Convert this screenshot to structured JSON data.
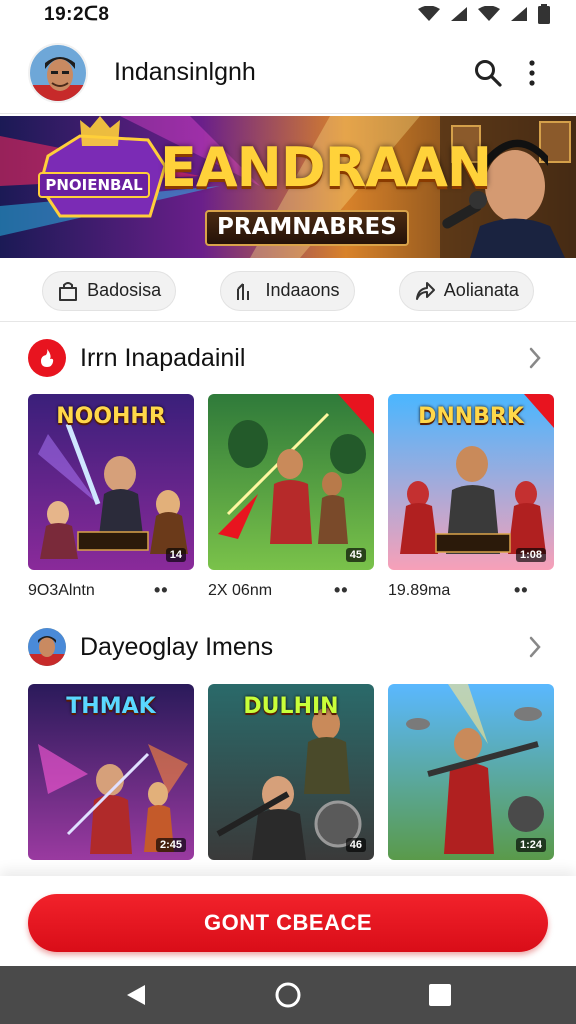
{
  "status_bar": {
    "time": "19:2ᑕ8"
  },
  "app_bar": {
    "title": "Indansinlgnh"
  },
  "banner": {
    "headline": "EANDRAAN",
    "subtitle": "PRAMNABRES",
    "badge": "PNOIENBAL"
  },
  "chips": [
    {
      "label": "Badosisa",
      "icon": "bag-icon"
    },
    {
      "label": "Indaaons",
      "icon": "bars-icon"
    },
    {
      "label": "Aolianata",
      "icon": "share-icon"
    }
  ],
  "sections": [
    {
      "title": "Irrn Inapadainil",
      "icon": "fire-icon",
      "items": [
        {
          "thumb_title": "NOOHHR",
          "duration": "14",
          "meta": "9О3Alntn"
        },
        {
          "thumb_title": "",
          "duration": "45",
          "meta": "2X 06nm"
        },
        {
          "thumb_title": "DNNBRK",
          "duration": "1:08",
          "meta": "19.89ma"
        }
      ]
    },
    {
      "title": "Dayeoglay Imens",
      "icon": "user-icon",
      "items": [
        {
          "thumb_title": "THMAK",
          "duration": "2:45",
          "meta": ""
        },
        {
          "thumb_title": "DULHIN",
          "duration": "46",
          "meta": ""
        },
        {
          "thumb_title": "",
          "duration": "1:24",
          "meta": ""
        }
      ]
    }
  ],
  "cta": {
    "label": "GONT CBEACE"
  },
  "colors": {
    "accent": "#e8141f",
    "nav_bar": "#4a4a4a"
  }
}
